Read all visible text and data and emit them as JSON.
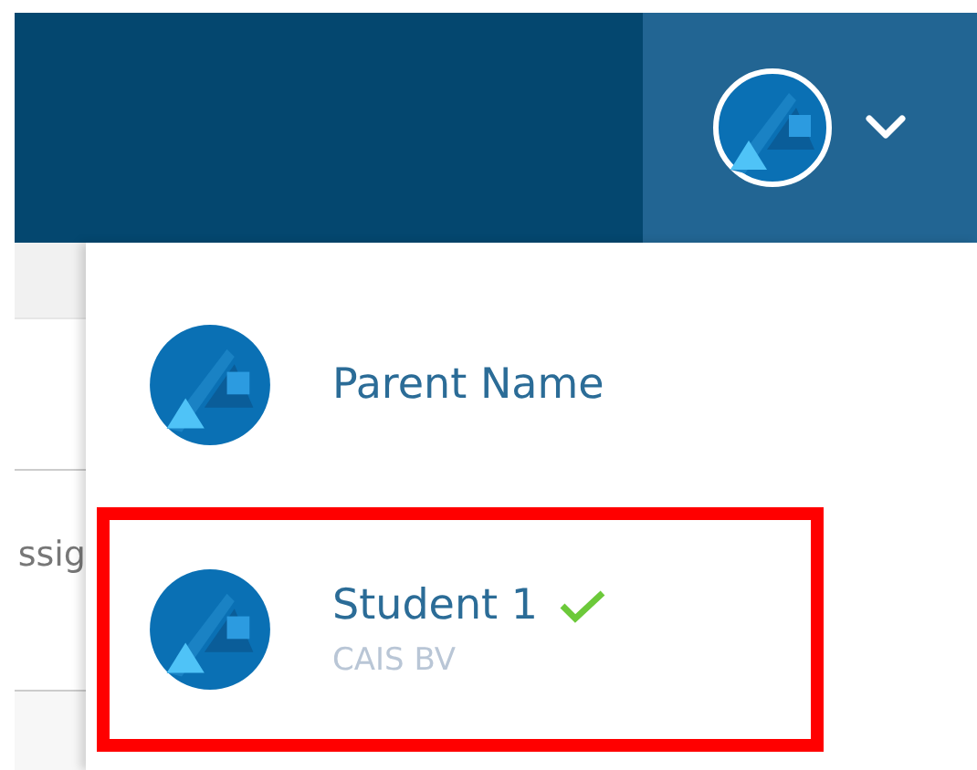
{
  "header": {
    "account_button": {
      "expanded": true
    }
  },
  "background_page": {
    "partial_text": "ssig"
  },
  "account_menu": {
    "items": [
      {
        "name": "Parent Name",
        "selected": false,
        "highlighted": false
      },
      {
        "name": "Student 1",
        "subtitle": "CAIS BV",
        "selected": true,
        "highlighted": true
      }
    ]
  }
}
